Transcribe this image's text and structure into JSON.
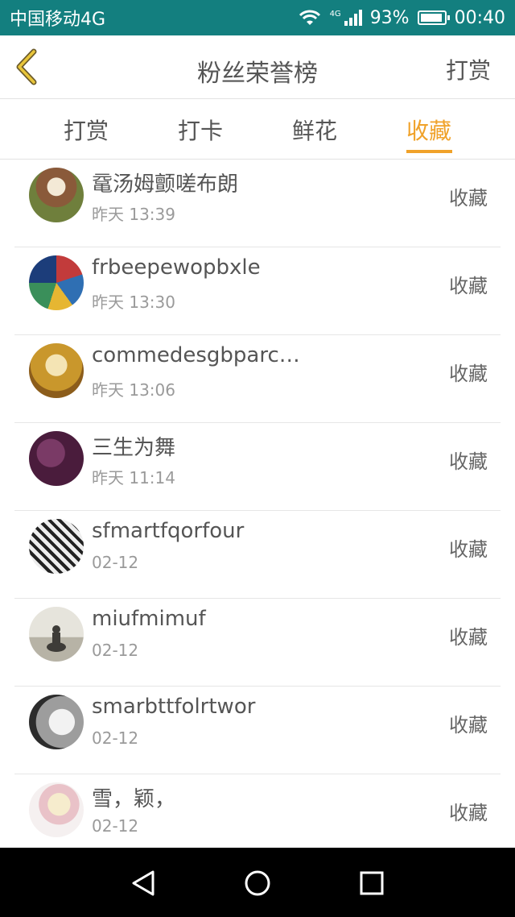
{
  "status_bar": {
    "carrier": "中国移动4G",
    "network_badge": "4G",
    "battery": "93%",
    "battery_level": 0.93,
    "time": "00:40"
  },
  "header": {
    "title": "粉丝荣誉榜",
    "action_label": "打赏",
    "back_icon": "chevron-left-icon"
  },
  "tabs": [
    {
      "label": "打赏",
      "active": false
    },
    {
      "label": "打卡",
      "active": false
    },
    {
      "label": "鲜花",
      "active": false
    },
    {
      "label": "收藏",
      "active": true
    }
  ],
  "accent_color": "#f0a22a",
  "list": {
    "items": [
      {
        "name": "鼋汤姆颤嗟布朗",
        "time": "昨天 13:39",
        "action": "收藏"
      },
      {
        "name": "frbeepewopbxle",
        "time": "昨天 13:30",
        "action": "收藏"
      },
      {
        "name": "commedesgbparc…",
        "time": "昨天 13:06",
        "action": "收藏"
      },
      {
        "name": "三生为舞",
        "time": "昨天 11:14",
        "action": "收藏"
      },
      {
        "name": "sfmartfqorfour",
        "time": "02-12",
        "action": "收藏"
      },
      {
        "name": "miufmimuf",
        "time": "02-12",
        "action": "收藏"
      },
      {
        "name": "smarbttfolrtwor",
        "time": "02-12",
        "action": "收藏"
      },
      {
        "name": "雪，颖，",
        "time": "02-12",
        "action": "收藏"
      }
    ]
  },
  "nav_bar": {
    "icons": [
      "back-triangle-icon",
      "home-circle-icon",
      "recents-square-icon"
    ]
  }
}
